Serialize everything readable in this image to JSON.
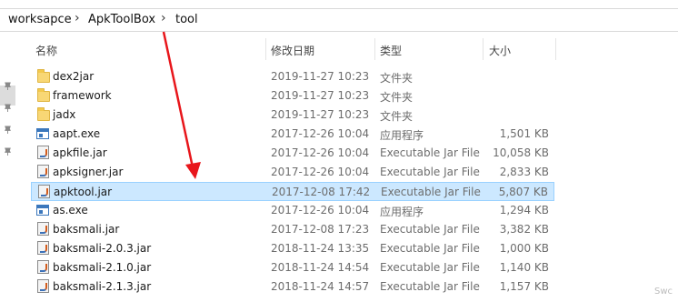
{
  "breadcrumb": [
    "worksapce",
    "ApkToolBox",
    "tool"
  ],
  "columns": {
    "name": "名称",
    "date": "修改日期",
    "type": "类型",
    "size": "大小"
  },
  "files": [
    {
      "name": "dex2jar",
      "date": "2019-11-27 10:23",
      "type": "文件夹",
      "size": "",
      "icon": "folder-icon"
    },
    {
      "name": "framework",
      "date": "2019-11-27 10:23",
      "type": "文件夹",
      "size": "",
      "icon": "folder-icon"
    },
    {
      "name": "jadx",
      "date": "2019-11-27 10:23",
      "type": "文件夹",
      "size": "",
      "icon": "folder-icon"
    },
    {
      "name": "aapt.exe",
      "date": "2017-12-26 10:04",
      "type": "应用程序",
      "size": "1,501 KB",
      "icon": "exe-icon"
    },
    {
      "name": "apkfile.jar",
      "date": "2017-12-26 10:04",
      "type": "Executable Jar File",
      "size": "10,058 KB",
      "icon": "jar-icon"
    },
    {
      "name": "apksigner.jar",
      "date": "2017-12-26 10:04",
      "type": "Executable Jar File",
      "size": "2,833 KB",
      "icon": "jar-icon"
    },
    {
      "name": "apktool.jar",
      "date": "2017-12-08 17:42",
      "type": "Executable Jar File",
      "size": "5,807 KB",
      "icon": "jar-icon",
      "selected": true
    },
    {
      "name": "as.exe",
      "date": "2017-12-26 10:04",
      "type": "应用程序",
      "size": "1,294 KB",
      "icon": "exe-icon"
    },
    {
      "name": "baksmali.jar",
      "date": "2017-12-08 17:23",
      "type": "Executable Jar File",
      "size": "3,382 KB",
      "icon": "jar-icon"
    },
    {
      "name": "baksmali-2.0.3.jar",
      "date": "2018-11-24 13:35",
      "type": "Executable Jar File",
      "size": "1,000 KB",
      "icon": "jar-icon"
    },
    {
      "name": "baksmali-2.1.0.jar",
      "date": "2018-11-24 14:54",
      "type": "Executable Jar File",
      "size": "1,140 KB",
      "icon": "jar-icon"
    },
    {
      "name": "baksmali-2.1.3.jar",
      "date": "2018-11-24 14:57",
      "type": "Executable Jar File",
      "size": "1,157 KB",
      "icon": "jar-icon"
    }
  ],
  "watermark": "Swc",
  "annotation_color": "#e8161b"
}
